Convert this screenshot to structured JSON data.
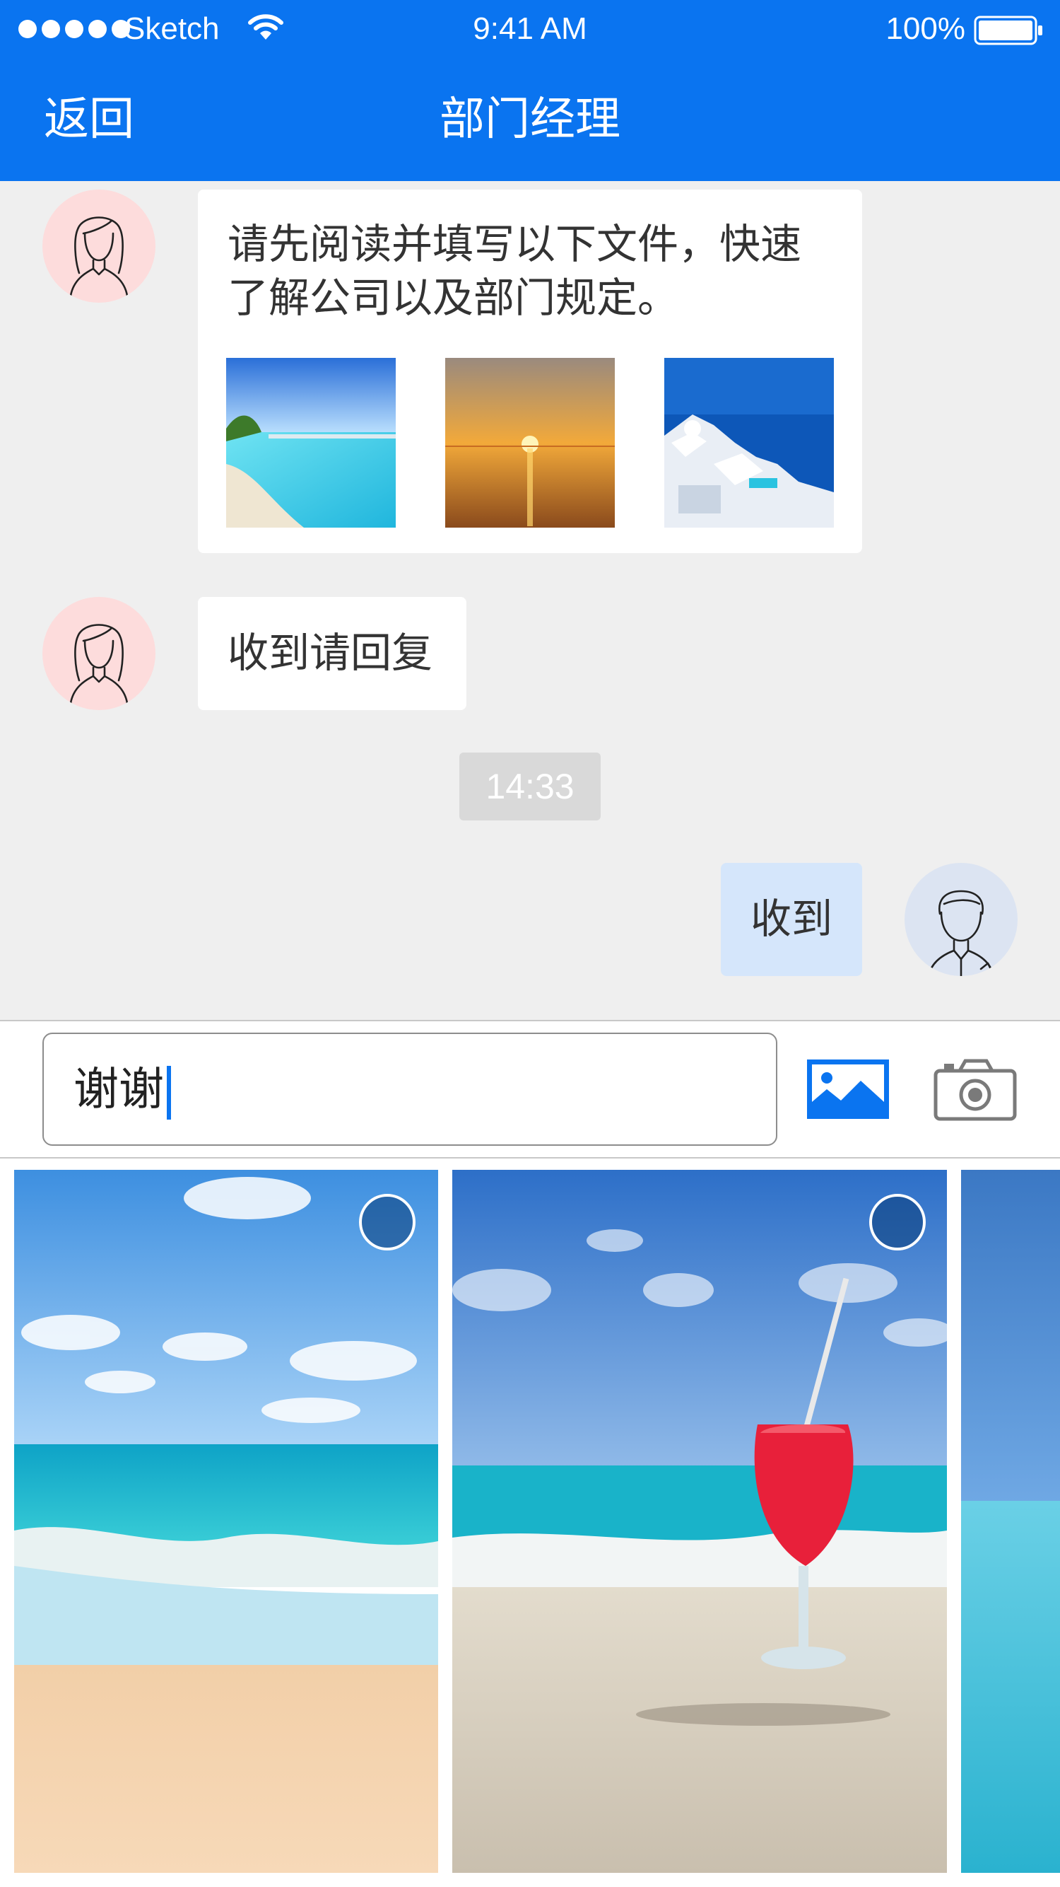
{
  "status_bar": {
    "carrier": "Sketch",
    "time": "9:41 AM",
    "battery": "100%"
  },
  "nav": {
    "back_label": "返回",
    "title": "部门经理"
  },
  "messages": [
    {
      "sender": "manager",
      "avatar": "female-avatar-icon",
      "text": "请先阅读并填写以下文件，快速了解公司以及部门规定。",
      "attachments": [
        "beach-photo",
        "sunset-photo",
        "santorini-photo"
      ]
    },
    {
      "sender": "manager",
      "avatar": "female-avatar-icon",
      "text": "收到请回复"
    },
    {
      "sender": "me",
      "avatar": "male-avatar-icon",
      "text": "收到"
    }
  ],
  "timestamp": "14:33",
  "composer": {
    "input_value": "谢谢",
    "gallery_icon": "image-icon",
    "camera_icon": "camera-icon"
  },
  "picker": {
    "photos": [
      {
        "name": "beach-waves-photo",
        "selected": false
      },
      {
        "name": "red-drink-beach-photo",
        "selected": false
      },
      {
        "name": "turquoise-sea-photo",
        "selected": false
      }
    ]
  },
  "colors": {
    "primary": "#0a74f0",
    "chat_background": "#efefef",
    "my_bubble": "#d5e6fb",
    "female_avatar_bg": "#fddcdc",
    "male_avatar_bg": "#dce4f2"
  }
}
